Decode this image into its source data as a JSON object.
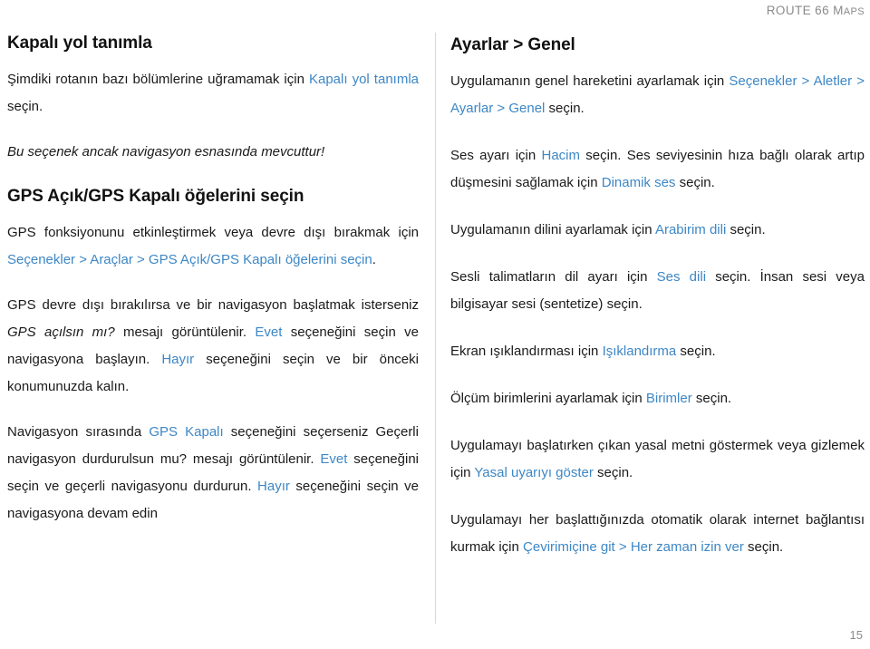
{
  "header": {
    "brand_main": "ROUTE 66 M",
    "brand_small": "APS"
  },
  "footer": {
    "page_number": "15"
  },
  "colors": {
    "link": "#3d87c6",
    "text": "#1a1a1a",
    "muted": "#8a8a8a",
    "rule": "#d8d8d8"
  },
  "left_column": {
    "section1": {
      "title": "Kapalı yol tanımla",
      "p1_a": "Şimdiki rotanın bazı bölümlerine uğramamak için ",
      "p1_link": "Kapalı yol tanımla",
      "p1_b": " seçin.",
      "note_italic": "Bu seçenek ancak navigasyon esnasında mevcuttur!"
    },
    "section2": {
      "title": "GPS Açık/GPS Kapalı öğelerini seçin",
      "p1_a": "GPS fonksiyonunu etkinleştirmek veya devre dışı bırakmak için ",
      "p1_link": "Seçenekler > Araçlar > GPS Açık/GPS Kapalı öğelerini seçin",
      "p1_b": ".",
      "p2_a": "GPS devre dışı bırakılırsa ve bir navigasyon başlatmak isterseniz ",
      "p2_italic": "GPS açılsın mı?",
      "p2_b": " mesajı görüntülenir. ",
      "p2_link1": "Evet",
      "p2_c": " seçeneğini seçin ve navigasyona başlayın. ",
      "p2_link2": "Hayır",
      "p2_d": " seçeneğini seçin ve bir önceki konumunuzda kalın.",
      "p3_a": "Navigasyon sırasında ",
      "p3_link1": "GPS Kapalı",
      "p3_b": " seçeneğini seçerseniz Geçerli navigasyon durdurulsun mu? mesajı görüntülenir. ",
      "p3_link2": "Evet",
      "p3_c": " seçeneğini seçin ve geçerli navigasyonu durdurun. ",
      "p3_link3": "Hayır",
      "p3_d": " seçeneğini seçin ve navigasyona devam edin"
    }
  },
  "right_column": {
    "title": "Ayarlar > Genel",
    "p1_a": "Uygulamanın genel hareketini ayarlamak için ",
    "p1_link": "Seçenekler > Aletler > Ayarlar > Genel",
    "p1_b": " seçin.",
    "p2_a": "Ses ayarı için ",
    "p2_link1": "Hacim",
    "p2_b": " seçin. Ses seviyesinin hıza bağlı olarak artıp düşmesini sağlamak için ",
    "p2_link2": "Dinamik ses",
    "p2_c": " seçin.",
    "p3_a": "Uygulamanın dilini ayarlamak için ",
    "p3_link": "Arabirim dili",
    "p3_b": " seçin.",
    "p4_a": "Sesli talimatların dil ayarı için ",
    "p4_link": "Ses dili",
    "p4_b": " seçin. İnsan sesi veya bilgisayar sesi (sentetize) seçin.",
    "p5_a": "Ekran ışıklandırması için ",
    "p5_link": "Işıklandırma",
    "p5_b": " seçin.",
    "p6_a": "Ölçüm birimlerini ayarlamak için ",
    "p6_link": "Birimler",
    "p6_b": " seçin.",
    "p7_a": "Uygulamayı başlatırken çıkan yasal metni göstermek veya gizlemek için ",
    "p7_link": "Yasal uyarıyı göster",
    "p7_b": " seçin.",
    "p8_a": "Uygulamayı her başlattığınızda otomatik olarak internet bağlantısı kurmak için ",
    "p8_link": "Çevirimiçine git > Her zaman izin ver",
    "p8_b": " seçin."
  }
}
